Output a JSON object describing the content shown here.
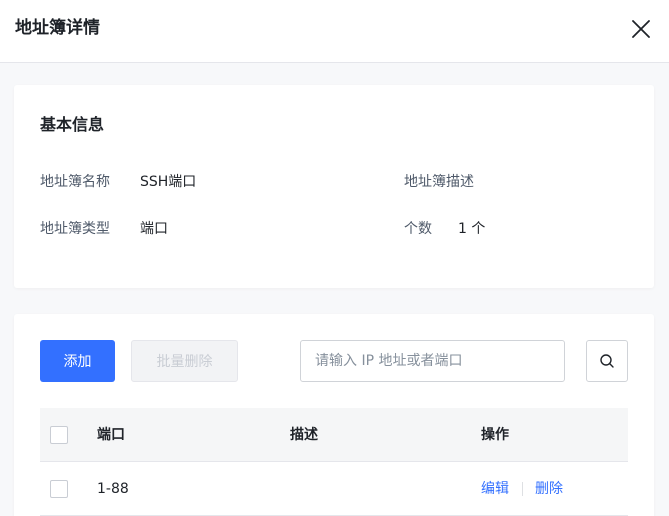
{
  "drawer": {
    "title": "地址簿详情",
    "close_icon": "close-icon"
  },
  "basic_info": {
    "title": "基本信息",
    "fields": {
      "name_label": "地址簿名称",
      "name_value": "SSH端口",
      "desc_label": "地址簿描述",
      "desc_value": "",
      "type_label": "地址簿类型",
      "type_value": "端口",
      "count_label": "个数",
      "count_value": "1 个"
    }
  },
  "list": {
    "toolbar": {
      "add_label": "添加",
      "batch_delete_label": "批量删除",
      "search_placeholder": "请输入 IP 地址或者端口",
      "search_value": "",
      "search_icon": "search-icon"
    },
    "columns": {
      "port": "端口",
      "description": "描述",
      "actions": "操作"
    },
    "rows": [
      {
        "port": "1-88",
        "description": "",
        "edit_label": "编辑",
        "delete_label": "删除"
      }
    ]
  },
  "colors": {
    "primary": "#3370ff",
    "background": "#f7f8fa",
    "text": "#1f2329",
    "label": "#4e5969"
  }
}
